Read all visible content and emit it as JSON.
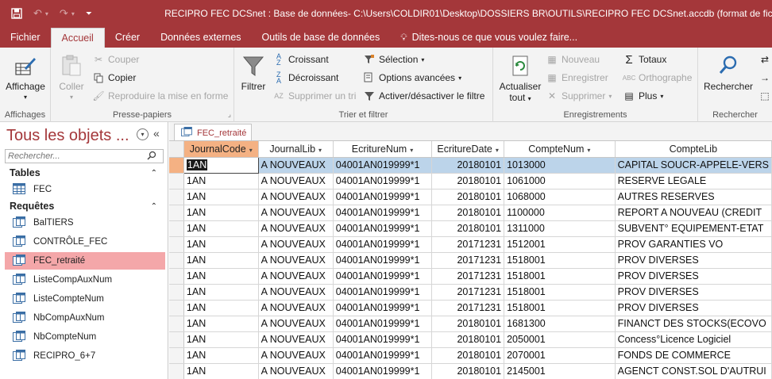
{
  "titlebar": {
    "title": "RECIPRO FEC DCSnet : Base de données- C:\\Users\\COLDIR01\\Desktop\\DOSSIERS BR\\OUTILS\\RECIPRO FEC DCSnet.accdb (format de fichier Acc",
    "save_icon": "save-icon",
    "undo_icon": "undo-icon",
    "redo_icon": "redo-icon",
    "customize_icon": "customize-qat-icon"
  },
  "ribbon_tabs": {
    "fichier": "Fichier",
    "accueil": "Accueil",
    "creer": "Créer",
    "donnees_externes": "Données externes",
    "outils": "Outils de base de données",
    "tell_me": "Dites-nous ce que vous voulez faire..."
  },
  "ribbon": {
    "affichages": {
      "label": "Affichages",
      "affichage": "Affichage"
    },
    "presse_papiers": {
      "label": "Presse-papiers",
      "coller": "Coller",
      "couper": "Couper",
      "copier": "Copier",
      "reproduire": "Reproduire la mise en forme"
    },
    "trier": {
      "label": "Trier et filtrer",
      "filtrer": "Filtrer",
      "croissant": "Croissant",
      "decroissant": "Décroissant",
      "supprimer_tri": "Supprimer un tri",
      "selection": "Sélection",
      "options": "Options avancées",
      "activer": "Activer/désactiver le filtre"
    },
    "enregistrements": {
      "label": "Enregistrements",
      "actualiser_l1": "Actualiser",
      "actualiser_l2": "tout",
      "nouveau": "Nouveau",
      "enregistrer": "Enregistrer",
      "supprimer": "Supprimer",
      "totaux": "Totaux",
      "orthographe": "Orthographe",
      "plus": "Plus"
    },
    "rechercher": {
      "label": "Rechercher",
      "rechercher": "Rechercher"
    }
  },
  "nav": {
    "title": "Tous les objets ...",
    "search_placeholder": "Rechercher...",
    "tables_header": "Tables",
    "queries_header": "Requêtes",
    "tables": [
      "FEC"
    ],
    "queries": [
      "BalTIERS",
      "CONTRÔLE_FEC",
      "FEC_retraité",
      "ListeCompAuxNum",
      "ListeCompteNum",
      "NbCompAuxNum",
      "NbCompteNum",
      "RECIPRO_6+7"
    ],
    "selected": "FEC_retraité"
  },
  "document": {
    "tab_label": "FEC_retraité",
    "columns": [
      "JournalCode",
      "JournalLib",
      "EcritureNum",
      "EcritureDate",
      "CompteNum",
      "CompteLib"
    ],
    "rows": [
      [
        "1AN",
        "A NOUVEAUX",
        "04001AN019999*1",
        "20180101",
        "1013000",
        "CAPITAL SOUCR-APPELE-VERS"
      ],
      [
        "1AN",
        "A NOUVEAUX",
        "04001AN019999*1",
        "20180101",
        "1061000",
        "RESERVE LEGALE"
      ],
      [
        "1AN",
        "A NOUVEAUX",
        "04001AN019999*1",
        "20180101",
        "1068000",
        "AUTRES RESERVES"
      ],
      [
        "1AN",
        "A NOUVEAUX",
        "04001AN019999*1",
        "20180101",
        "1100000",
        "REPORT A NOUVEAU (CREDIT"
      ],
      [
        "1AN",
        "A NOUVEAUX",
        "04001AN019999*1",
        "20180101",
        "1311000",
        "SUBVENT° EQUIPEMENT-ETAT"
      ],
      [
        "1AN",
        "A NOUVEAUX",
        "04001AN019999*1",
        "20171231",
        "1512001",
        "PROV GARANTIES VO"
      ],
      [
        "1AN",
        "A NOUVEAUX",
        "04001AN019999*1",
        "20171231",
        "1518001",
        "PROV DIVERSES"
      ],
      [
        "1AN",
        "A NOUVEAUX",
        "04001AN019999*1",
        "20171231",
        "1518001",
        "PROV DIVERSES"
      ],
      [
        "1AN",
        "A NOUVEAUX",
        "04001AN019999*1",
        "20171231",
        "1518001",
        "PROV DIVERSES"
      ],
      [
        "1AN",
        "A NOUVEAUX",
        "04001AN019999*1",
        "20171231",
        "1518001",
        "PROV DIVERSES"
      ],
      [
        "1AN",
        "A NOUVEAUX",
        "04001AN019999*1",
        "20180101",
        "1681300",
        "FINANCT DES STOCKS(ECOVO"
      ],
      [
        "1AN",
        "A NOUVEAUX",
        "04001AN019999*1",
        "20180101",
        "2050001",
        "Concess°Licence Logiciel"
      ],
      [
        "1AN",
        "A NOUVEAUX",
        "04001AN019999*1",
        "20180101",
        "2070001",
        "FONDS DE COMMERCE"
      ],
      [
        "1AN",
        "A NOUVEAUX",
        "04001AN019999*1",
        "20180101",
        "2145001",
        "AGENCT CONST.SOL D'AUTRUI"
      ]
    ]
  },
  "colors": {
    "accent": "#a4373a",
    "selection_row": "#bcd4ea",
    "selection_nav": "#f4a7a9",
    "header_selected": "#f4b183"
  }
}
